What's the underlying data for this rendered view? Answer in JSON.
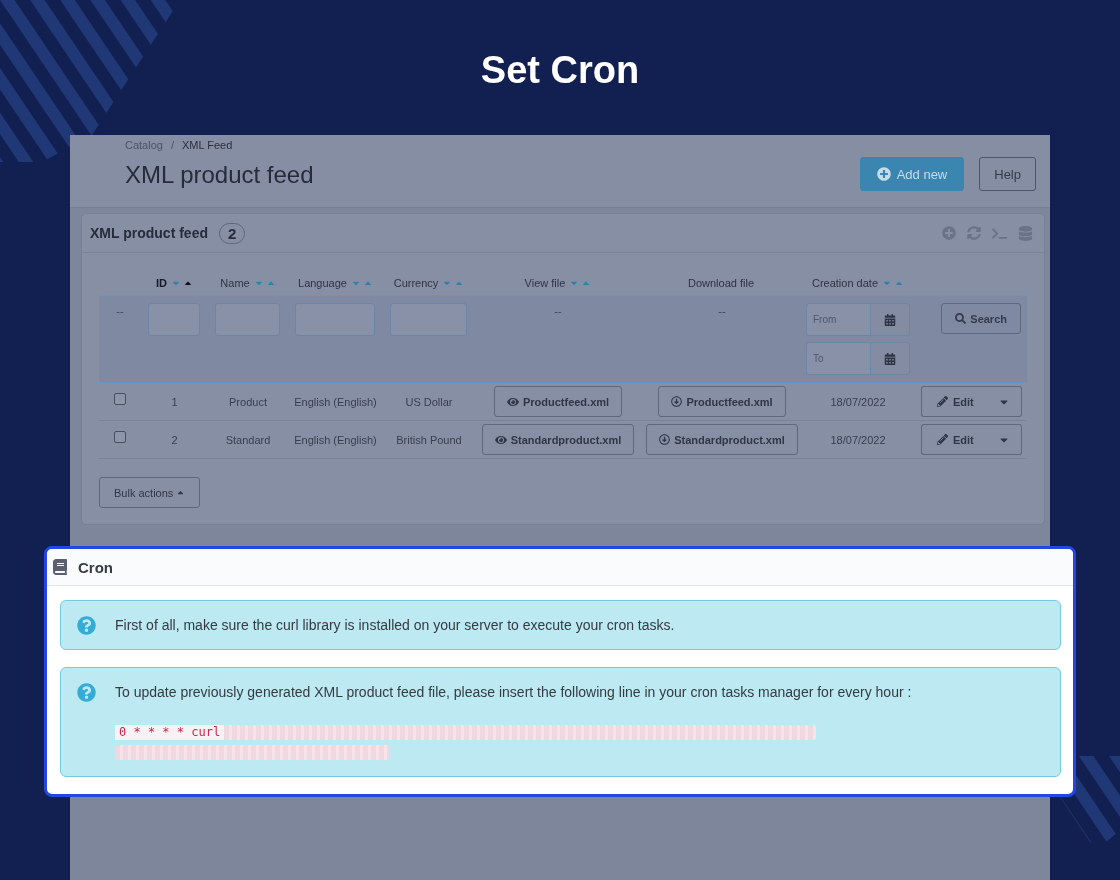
{
  "banner_title": "Set Cron",
  "breadcrumb": {
    "items": [
      "Catalog",
      "XML Feed"
    ],
    "separator": "/"
  },
  "page_title": "XML product feed",
  "header_buttons": [
    {
      "label": "Add new",
      "kind": "primary"
    },
    {
      "label": "Help",
      "kind": "default"
    }
  ],
  "list_panel": {
    "title": "XML product feed",
    "count": "2",
    "columns": [
      {
        "label": "ID",
        "sortable": true,
        "sorted_asc": true
      },
      {
        "label": "Name",
        "sortable": true,
        "sorted_asc": false
      },
      {
        "label": "Language",
        "sortable": true,
        "sorted_asc": false
      },
      {
        "label": "Currency",
        "sortable": true,
        "sorted_asc": false
      },
      {
        "label": "View file",
        "sortable": true,
        "sorted_asc": false
      },
      {
        "label": "Download file",
        "sortable": false
      },
      {
        "label": "Creation date",
        "sortable": true,
        "sorted_asc": false
      }
    ],
    "filters": [
      {
        "kind": "dash",
        "text": "--"
      },
      {
        "kind": "input"
      },
      {
        "kind": "input"
      },
      {
        "kind": "input"
      },
      {
        "kind": "input"
      },
      {
        "kind": "dash",
        "text": "--"
      },
      {
        "kind": "dash",
        "text": "--"
      },
      {
        "kind": "date_range",
        "from_placeholder": "From",
        "to_placeholder": "To"
      },
      {
        "kind": "button",
        "label": "Search"
      }
    ],
    "rows": [
      {
        "checked": false,
        "id": "1",
        "name": "Product",
        "language": "English (English)",
        "currency": "US Dollar",
        "view_file": "Productfeed.xml",
        "download_file": "Productfeed.xml",
        "creation_date": "18/07/2022",
        "action": "Edit"
      },
      {
        "checked": false,
        "id": "2",
        "name": "Standard",
        "language": "English (English)",
        "currency": "British Pound",
        "view_file": "Standardproduct.xml",
        "download_file": "Standardproduct.xml",
        "creation_date": "18/07/2022",
        "action": "Edit"
      }
    ],
    "bulk_actions": "Bulk actions"
  },
  "cron_panel": {
    "title": "Cron",
    "notes": [
      {
        "text": "First of all, make sure the curl library is installed on your server to execute your cron tasks."
      },
      {
        "text": "To update previously generated XML product feed file, please insert the following line in your cron tasks manager for every hour :",
        "command": "0 * * * * curl",
        "url_blurred": true
      }
    ]
  }
}
